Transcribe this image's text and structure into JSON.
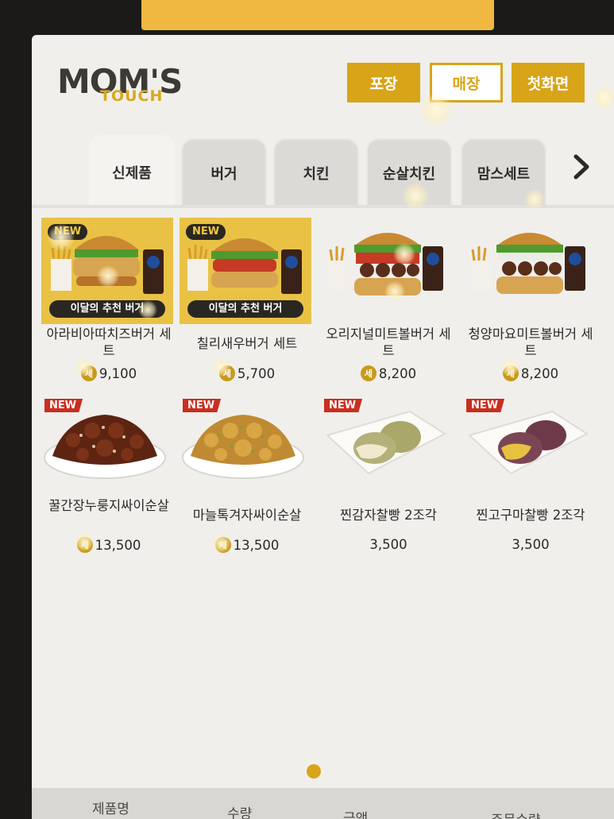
{
  "header": {
    "logo_mom": "MOM'S",
    "logo_touch": "TOUCH",
    "buttons": [
      {
        "label": "포장"
      },
      {
        "label": "매장"
      },
      {
        "label": "첫화면"
      }
    ]
  },
  "tabs": [
    {
      "label": "신제품"
    },
    {
      "label": "버거"
    },
    {
      "label": "치킨"
    },
    {
      "label": "순살치킨"
    },
    {
      "label": "맘스세트"
    }
  ],
  "products": [
    {
      "name": "아라비아따치즈버거 세트",
      "price": "9,100",
      "set": "세",
      "badge": "NEW",
      "promo": "이달의 추천 버거"
    },
    {
      "name": "칠리새우버거 세트",
      "price": "5,700",
      "set": "세",
      "badge": "NEW",
      "promo": "이달의 추천 버거"
    },
    {
      "name": "오리지널미트볼버거 세트",
      "price": "8,200",
      "set": "세"
    },
    {
      "name": "청양마요미트볼버거 세트",
      "price": "8,200",
      "set": "세"
    },
    {
      "name": "꿀간장누룽지싸이순살",
      "price": "13,500",
      "set": "세",
      "badge": "NEW"
    },
    {
      "name": "마늘톡겨자싸이순살",
      "price": "13,500",
      "set": "세",
      "badge": "NEW"
    },
    {
      "name": "찐감자찰빵 2조각",
      "price": "3,500",
      "badge": "NEW"
    },
    {
      "name": "찐고구마찰빵 2조각",
      "price": "3,500",
      "badge": "NEW"
    }
  ],
  "footer": {
    "product_name": "제품명",
    "quantity": "수량",
    "amount": "금액",
    "order_qty": "주문수량"
  },
  "colors": {
    "accent": "#d8a418",
    "new_flag": "#c92e1f"
  }
}
